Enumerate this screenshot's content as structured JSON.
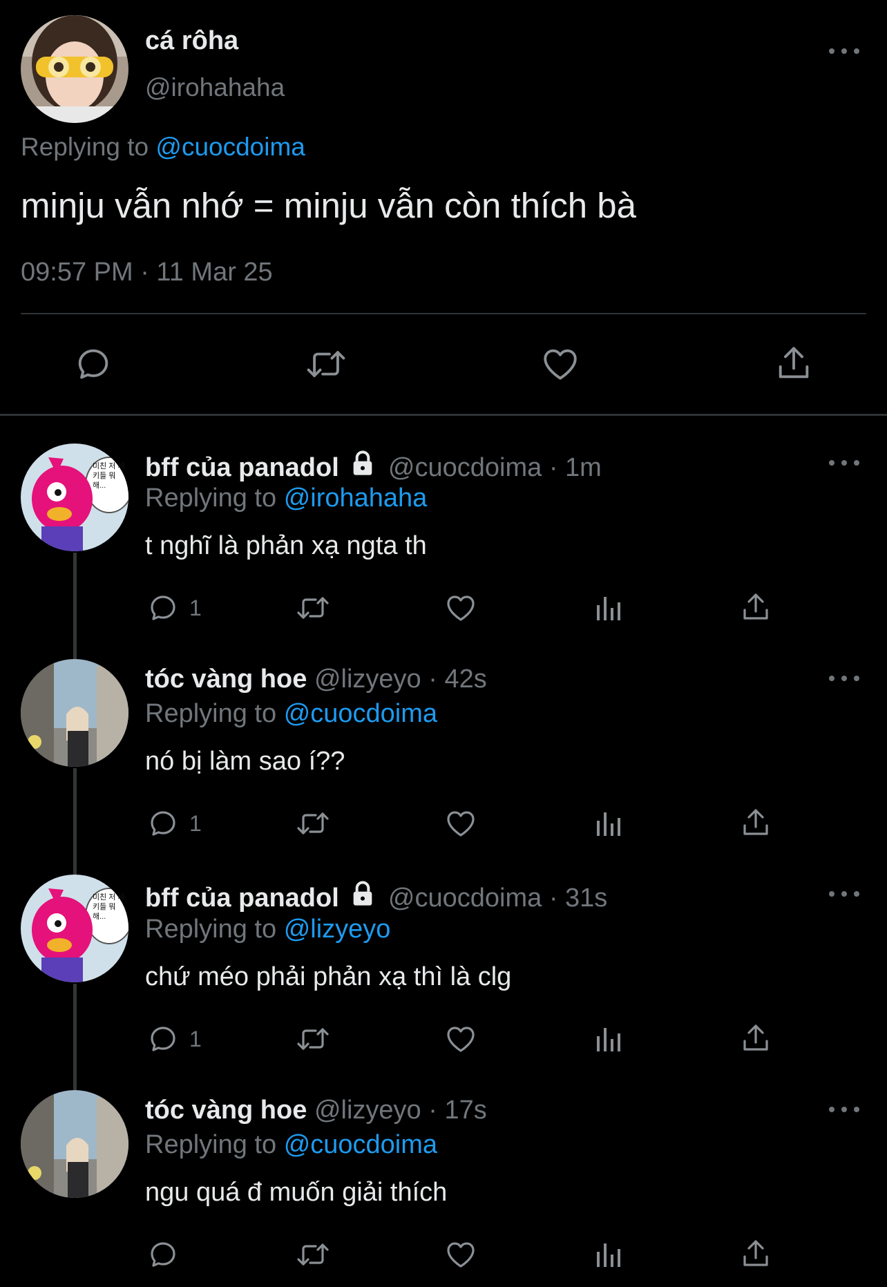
{
  "main_tweet": {
    "display_name": "cá rôha",
    "handle": "@irohahaha",
    "replying_prefix": "Replying to",
    "replying_to": "@cuocdoima",
    "text": "minju vẫn nhớ = minju vẫn còn thích bà",
    "timestamp": "09:57 PM · 11 Mar 25"
  },
  "replies": [
    {
      "display_name": "bff của panadol",
      "locked": true,
      "handle": "@cuocdoima",
      "time": "· 1m",
      "replying_prefix": "Replying to",
      "replying_to": "@irohahaha",
      "text": "t nghĩ là phản xạ ngta th",
      "reply_count": "1"
    },
    {
      "display_name": "tóc vàng hoe",
      "locked": false,
      "handle": "@lizyeyo",
      "time": "· 42s",
      "replying_prefix": "Replying to",
      "replying_to": "@cuocdoima",
      "text": "nó bị làm sao í??",
      "reply_count": "1"
    },
    {
      "display_name": "bff của panadol",
      "locked": true,
      "handle": "@cuocdoima",
      "time": "· 31s",
      "replying_prefix": "Replying to",
      "replying_to": "@lizyeyo",
      "text": "chứ méo phải phản xạ thì là clg",
      "reply_count": "1"
    },
    {
      "display_name": "tóc vàng hoe",
      "locked": false,
      "handle": "@lizyeyo",
      "time": "· 17s",
      "replying_prefix": "Replying to",
      "replying_to": "@cuocdoima",
      "text": "ngu quá đ muốn giải thích",
      "reply_count": ""
    }
  ],
  "speech_bubble_text": "미친 저 새키들 뭐해...",
  "colors": {
    "background": "#000000",
    "text": "#e7e9ea",
    "muted": "#71767b",
    "link": "#1d9bf0",
    "divider": "#2f3336"
  }
}
